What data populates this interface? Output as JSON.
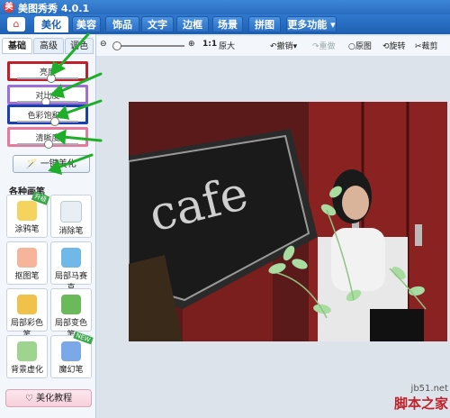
{
  "app": {
    "title": "美图秀秀 4.0.1"
  },
  "nav": {
    "home_icon": "home-icon",
    "tabs": [
      "美化",
      "美容",
      "饰品",
      "文字",
      "边框",
      "场景",
      "拼图",
      "更多功能 ▾"
    ]
  },
  "sidebar": {
    "subtabs": [
      "基础",
      "高级",
      "调色"
    ],
    "sliders": [
      {
        "label": "亮度",
        "value": 0.55,
        "box_color": "#c0202a"
      },
      {
        "label": "对比度",
        "value": 0.45,
        "box_color": "#9b6fd6"
      },
      {
        "label": "色彩饱和度",
        "value": 0.6,
        "box_color": "#1b3fb0"
      },
      {
        "label": "清晰度",
        "value": 0.5,
        "box_color": "#e7799c"
      }
    ],
    "one_click": "一键美化",
    "brush_heading": "各种画笔",
    "tools": [
      {
        "label": "涂鸦笔",
        "icon": "pencil-icon",
        "badge": "升级"
      },
      {
        "label": "消除笔",
        "icon": "eraser-icon",
        "badge": ""
      },
      {
        "label": "抠图笔",
        "icon": "cutout-icon",
        "badge": ""
      },
      {
        "label": "局部马赛克",
        "icon": "mosaic-icon",
        "badge": ""
      },
      {
        "label": "局部彩色笔",
        "icon": "color-brush-icon",
        "badge": ""
      },
      {
        "label": "局部变色笔",
        "icon": "recolor-icon",
        "badge": ""
      },
      {
        "label": "背景虚化",
        "icon": "blur-icon",
        "badge": ""
      },
      {
        "label": "魔幻笔",
        "icon": "magic-wand-icon",
        "badge": "NEW"
      }
    ],
    "tutorial": "美化教程"
  },
  "toolbar": {
    "fit_label": "1:1",
    "original_label": "原大",
    "undo": "撤销",
    "redo": "重做",
    "original_image": "原图",
    "rotate": "旋转",
    "crop": "裁剪"
  },
  "photo": {
    "sign_text": "cafe"
  },
  "watermark": {
    "site": "jb51.net",
    "name": "脚本之家"
  },
  "colors": {
    "arrow": "#1fae2a",
    "brand_blue": "#2a6cc0"
  }
}
